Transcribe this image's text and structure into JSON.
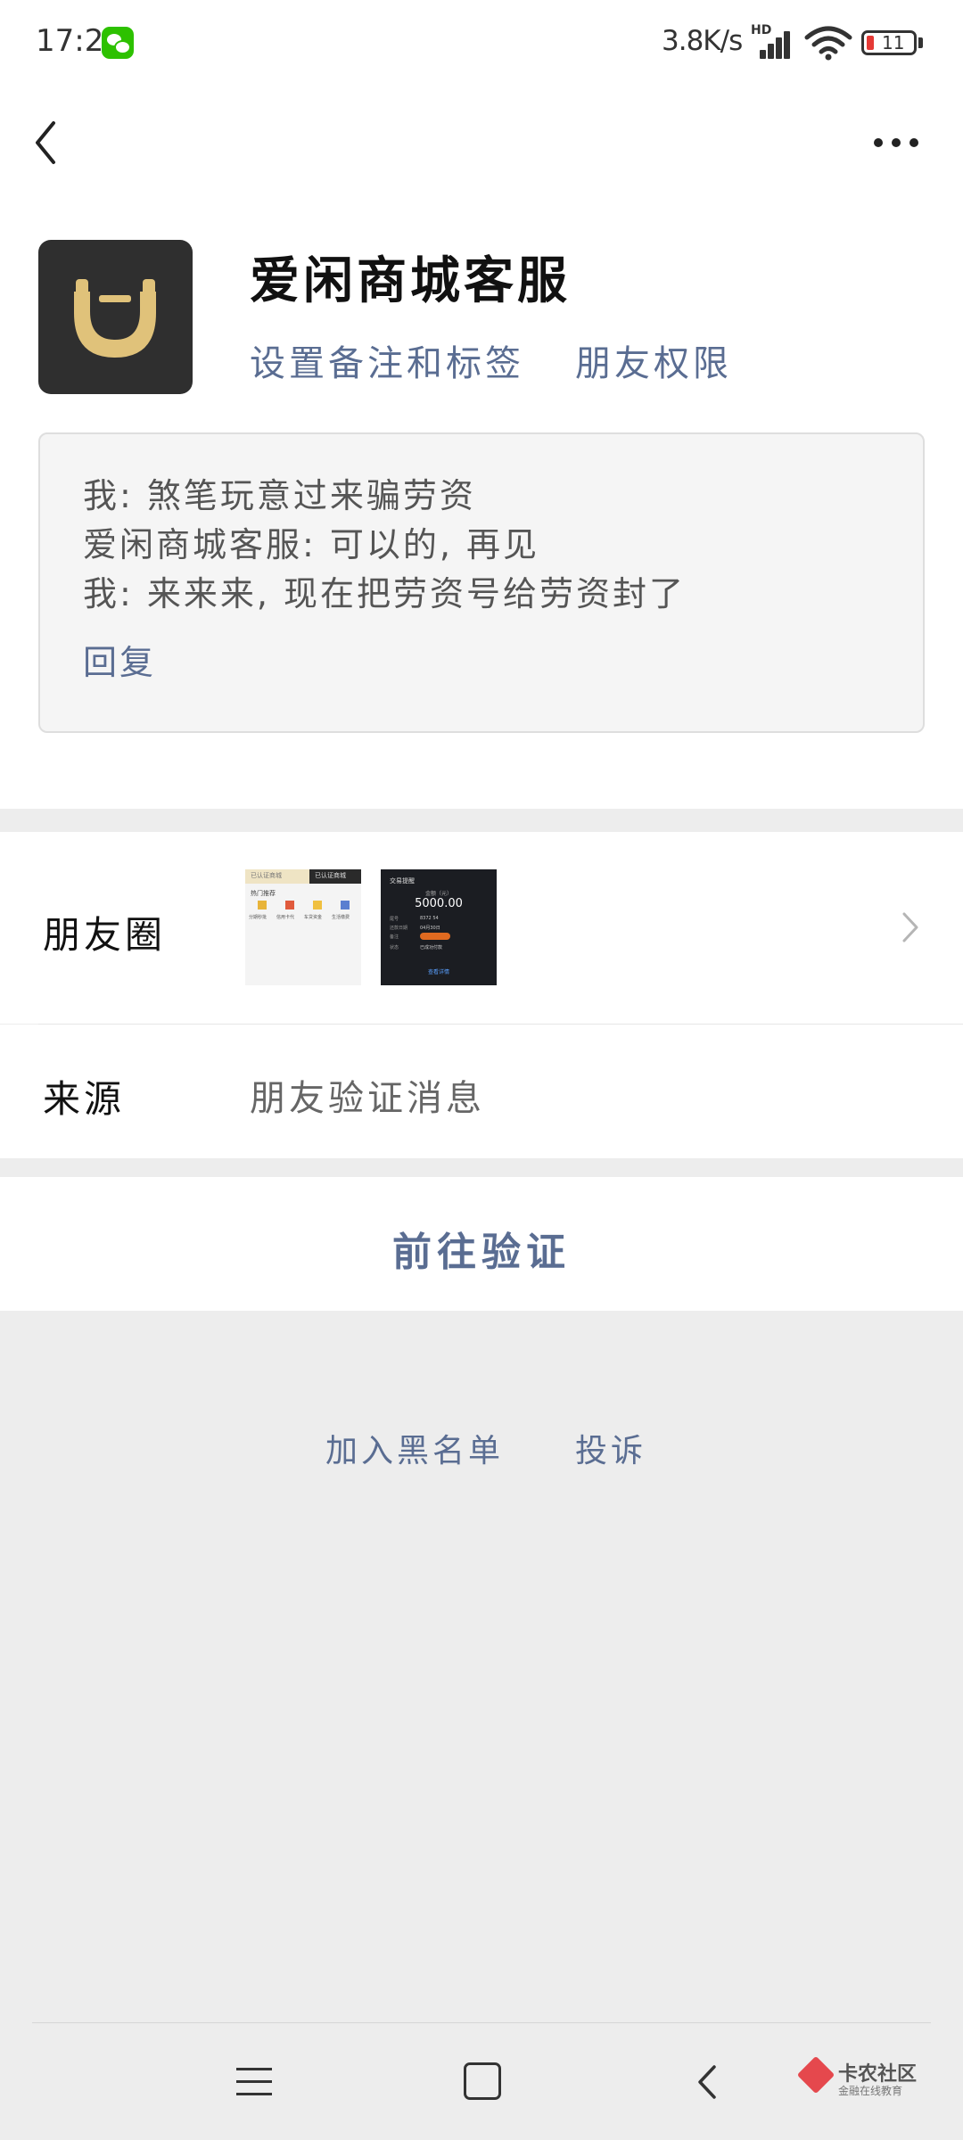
{
  "status_bar": {
    "time": "17:23",
    "network_speed": "3.8K/s",
    "signal_label": "HD",
    "battery_level": "11",
    "icons": [
      "wechat-notification-icon",
      "signal-icon",
      "wifi-icon",
      "battery-icon"
    ]
  },
  "navbar": {
    "back_icon": "chevron-left-icon",
    "more_icon": "more-dots-icon"
  },
  "profile": {
    "name": "爱闲商城客服",
    "remark_link": "设置备注和标签",
    "permission_link": "朋友权限",
    "avatar_icon": "smile-logo-icon",
    "avatar_colors": {
      "background": "#2f2f2f",
      "logo": "#e0c27a"
    }
  },
  "message_box": {
    "lines": [
      "我: 煞笔玩意过来骗劳资",
      "爱闲商城客服: 可以的, 再见",
      "我: 来来来, 现在把劳资号给劳资封了"
    ],
    "reply_label": "回复"
  },
  "moments_row": {
    "label": "朋友圈",
    "thumbnails": [
      {
        "top_tabs": [
          "已认证商城",
          "已认证商城"
        ],
        "section_title": "热门推荐",
        "items": [
          "分期秒批",
          "信用卡代",
          "车贷资金",
          "生活缴费"
        ]
      },
      {
        "title": "交易提醒",
        "label": "金额（元）",
        "amount": "5000.00",
        "rows": [
          {
            "key": "尾号",
            "value": "8372 54"
          },
          {
            "key": "还款日期",
            "value": "04月30日"
          },
          {
            "key": "备注",
            "value": ""
          },
          {
            "key": "状态",
            "value": "已成功付款"
          }
        ],
        "button": "查看详情"
      }
    ]
  },
  "source_row": {
    "label": "来源",
    "value": "朋友验证消息"
  },
  "verify_button": {
    "label": "前往验证"
  },
  "bottom_actions": {
    "blacklist": "加入黑名单",
    "complain": "投诉"
  },
  "system_nav": {
    "icons": [
      "menu-icon",
      "home-icon",
      "back-icon"
    ]
  },
  "watermark": {
    "title": "卡农社区",
    "subtitle": "金融在线教育"
  },
  "colors": {
    "link": "#5a6d92",
    "page_bg": "#ededed",
    "card_bg": "#ffffff",
    "message_bg": "#f5f5f5"
  }
}
